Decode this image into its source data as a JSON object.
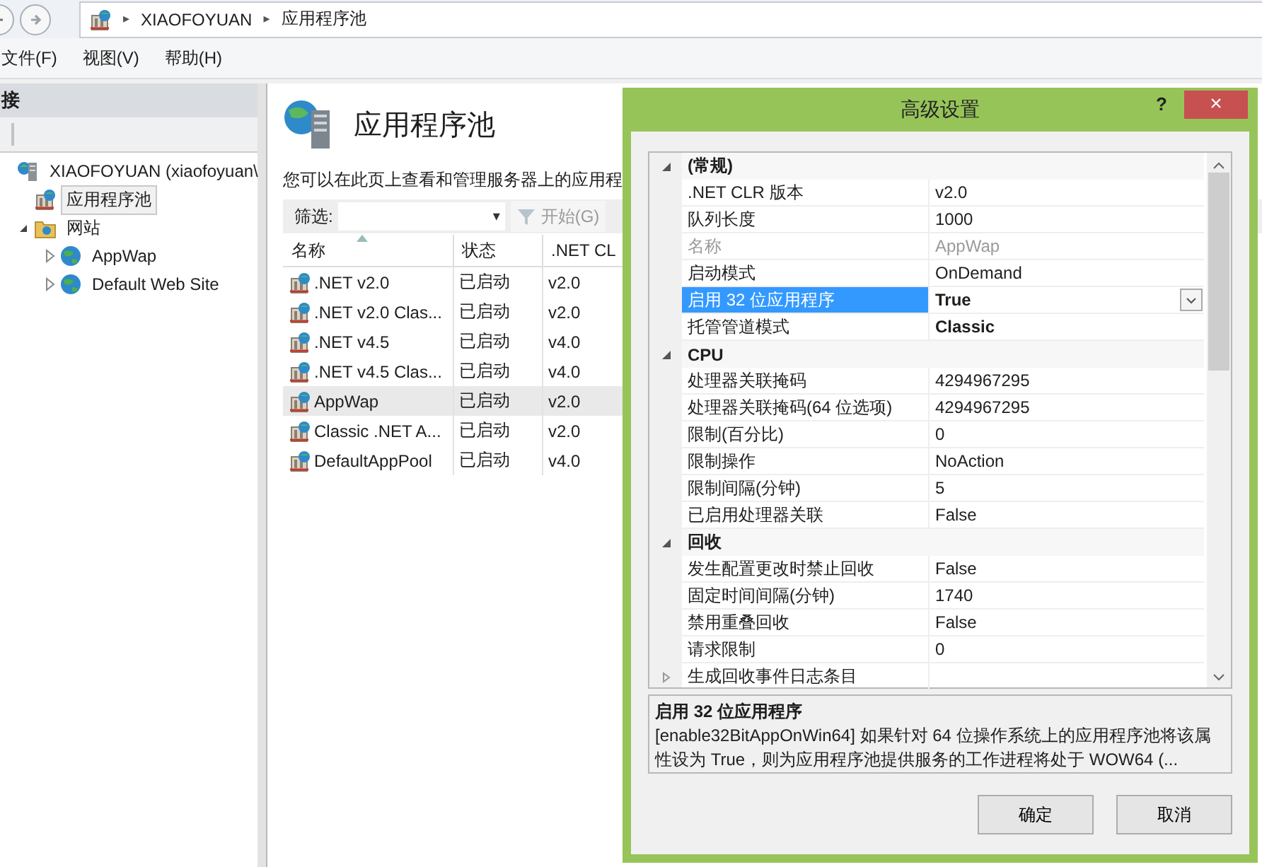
{
  "address_bar": {
    "separator": "▸",
    "segments": [
      {
        "label": "XIAOFOYUAN"
      },
      {
        "label": "应用程序池"
      }
    ]
  },
  "menu": [
    "文件(F)",
    "视图(V)",
    "帮助(H)"
  ],
  "connections": {
    "title": "接",
    "tree": [
      {
        "label": "XIAOFOYUAN (xiaofoyuan\\",
        "kind": "server",
        "selected": false,
        "children": [
          {
            "label": "应用程序池",
            "kind": "pool",
            "selected": true
          },
          {
            "label": "网站",
            "kind": "folder",
            "selected": false,
            "expanded": true,
            "children": [
              {
                "label": "AppWap",
                "kind": "site",
                "selected": false,
                "expanded": false
              },
              {
                "label": "Default Web Site",
                "kind": "site",
                "selected": false,
                "expanded": false
              }
            ]
          }
        ]
      }
    ]
  },
  "main": {
    "title": "应用程序池",
    "description": "您可以在此页上查看和管理服务器上的应用程",
    "filter": {
      "label": "筛选:",
      "dropdown": "▾",
      "go": "开始(G)"
    },
    "columns": [
      "名称",
      "状态",
      ".NET CL"
    ],
    "rows": [
      {
        "name": ".NET v2.0",
        "status": "已启动",
        "clr": "v2.0",
        "selected": false
      },
      {
        "name": ".NET v2.0 Clas...",
        "status": "已启动",
        "clr": "v2.0",
        "selected": false
      },
      {
        "name": ".NET v4.5",
        "status": "已启动",
        "clr": "v4.0",
        "selected": false
      },
      {
        "name": ".NET v4.5 Clas...",
        "status": "已启动",
        "clr": "v4.0",
        "selected": false
      },
      {
        "name": "AppWap",
        "status": "已启动",
        "clr": "v2.0",
        "selected": true
      },
      {
        "name": "Classic .NET A...",
        "status": "已启动",
        "clr": "v2.0",
        "selected": false
      },
      {
        "name": "DefaultAppPool",
        "status": "已启动",
        "clr": "v4.0",
        "selected": false
      }
    ]
  },
  "dialog": {
    "title": "高级设置",
    "help": "?",
    "close": "×",
    "groups": [
      {
        "name": "(常规)",
        "expanded": true,
        "items": [
          {
            "label": ".NET CLR 版本",
            "value": "v2.0",
            "kind": "choice",
            "selected": false,
            "readonly": false,
            "modified": false
          },
          {
            "label": "队列长度",
            "value": "1000",
            "kind": "text",
            "selected": false,
            "readonly": false,
            "modified": false
          },
          {
            "label": "名称",
            "value": "AppWap",
            "kind": "text",
            "selected": false,
            "readonly": true,
            "modified": false
          },
          {
            "label": "启动模式",
            "value": "OnDemand",
            "kind": "choice",
            "selected": false,
            "readonly": false,
            "modified": false
          },
          {
            "label": "启用 32 位应用程序",
            "value": "True",
            "kind": "choice",
            "selected": true,
            "readonly": false,
            "modified": true
          },
          {
            "label": "托管管道模式",
            "value": "Classic",
            "kind": "choice",
            "selected": false,
            "readonly": false,
            "modified": true
          }
        ]
      },
      {
        "name": "CPU",
        "expanded": true,
        "items": [
          {
            "label": "处理器关联掩码",
            "value": "4294967295",
            "kind": "text",
            "selected": false,
            "readonly": false,
            "modified": false
          },
          {
            "label": "处理器关联掩码(64 位选项)",
            "value": "4294967295",
            "kind": "text",
            "selected": false,
            "readonly": false,
            "modified": false
          },
          {
            "label": "限制(百分比)",
            "value": "0",
            "kind": "text",
            "selected": false,
            "readonly": false,
            "modified": false
          },
          {
            "label": "限制操作",
            "value": "NoAction",
            "kind": "choice",
            "selected": false,
            "readonly": false,
            "modified": false
          },
          {
            "label": "限制间隔(分钟)",
            "value": "5",
            "kind": "text",
            "selected": false,
            "readonly": false,
            "modified": false
          },
          {
            "label": "已启用处理器关联",
            "value": "False",
            "kind": "choice",
            "selected": false,
            "readonly": false,
            "modified": false
          }
        ]
      },
      {
        "name": "回收",
        "expanded": true,
        "items": [
          {
            "label": "发生配置更改时禁止回收",
            "value": "False",
            "kind": "choice",
            "selected": false,
            "readonly": false,
            "modified": false
          },
          {
            "label": "固定时间间隔(分钟)",
            "value": "1740",
            "kind": "text",
            "selected": false,
            "readonly": false,
            "modified": false
          },
          {
            "label": "禁用重叠回收",
            "value": "False",
            "kind": "choice",
            "selected": false,
            "readonly": false,
            "modified": false
          },
          {
            "label": "请求限制",
            "value": "0",
            "kind": "text",
            "selected": false,
            "readonly": false,
            "modified": false
          },
          {
            "label": "生成回收事件日志条目",
            "kind": "collection",
            "selected": false,
            "readonly": false,
            "modified": false
          }
        ]
      }
    ],
    "description": {
      "title": "启用 32 位应用程序",
      "text": "[enable32BitAppOnWin64] 如果针对 64 位操作系统上的应用程序池将该属性设为 True，则为应用程序池提供服务的工作进程将处于 WOW64 (..."
    },
    "buttons": [
      "确定",
      "取消"
    ]
  }
}
